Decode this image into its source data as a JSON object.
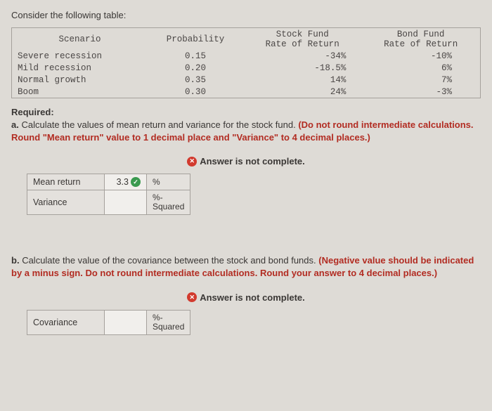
{
  "intro": "Consider the following table:",
  "table": {
    "headers": {
      "scenario": "Scenario",
      "probability": "Probability",
      "stock_line1": "Stock Fund",
      "stock_line2": "Rate of Return",
      "bond_line1": "Bond Fund",
      "bond_line2": "Rate of Return"
    },
    "rows": [
      {
        "scenario": "Severe recession",
        "probability": "0.15",
        "stock": "-34%",
        "bond": "-10%"
      },
      {
        "scenario": "Mild recession",
        "probability": "0.20",
        "stock": "-18.5%",
        "bond": "6%"
      },
      {
        "scenario": "Normal growth",
        "probability": "0.35",
        "stock": "14%",
        "bond": "7%"
      },
      {
        "scenario": "Boom",
        "probability": "0.30",
        "stock": "24%",
        "bond": "-3%"
      }
    ]
  },
  "required_label": "Required:",
  "part_a": {
    "lead": "a.",
    "text_plain": "Calculate the values of mean return and variance for the stock fund. ",
    "text_red": "(Do not round intermediate calculations. Round \"Mean return\" value to 1 decimal place and \"Variance\" to 4 decimal places.)"
  },
  "answer_status": "Answer is not complete.",
  "answer_table_a": {
    "rows": [
      {
        "label": "Mean return",
        "value": "3.3",
        "has_check": true,
        "unit": "%"
      },
      {
        "label": "Variance",
        "value": "",
        "has_check": false,
        "unit": "%-\nSquared"
      }
    ]
  },
  "part_b": {
    "lead": "b.",
    "text_plain": "Calculate the value of the covariance between the stock and bond funds. ",
    "text_red": "(Negative value should be indicated by a minus sign. Do not round intermediate calculations. Round your answer to 4 decimal places.)"
  },
  "answer_table_b": {
    "rows": [
      {
        "label": "Covariance",
        "value": "",
        "has_check": false,
        "unit": "%-\nSquared"
      }
    ]
  },
  "icons": {
    "x": "✕",
    "check": "✓"
  }
}
